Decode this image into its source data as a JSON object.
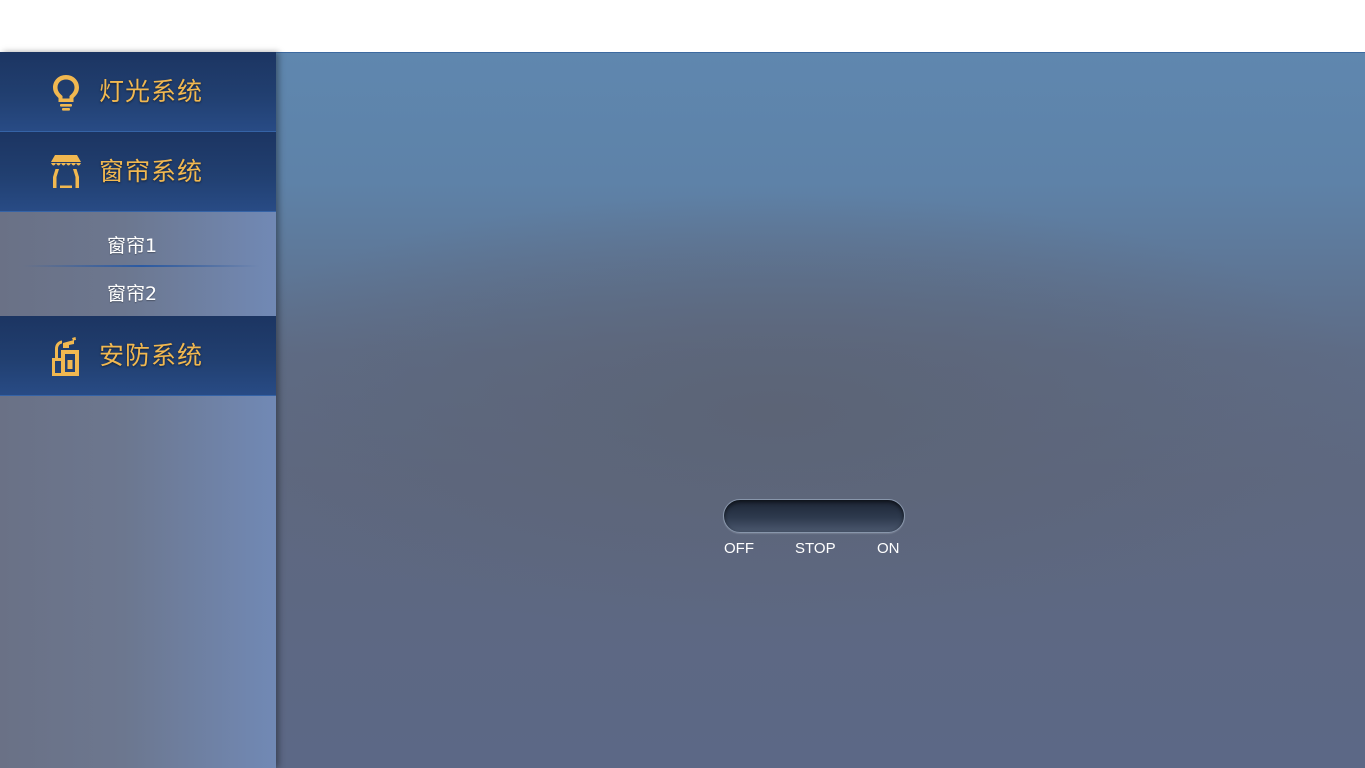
{
  "sidebar": {
    "menus": [
      {
        "label": "灯光系统",
        "icon": "lightbulb-icon"
      },
      {
        "label": "窗帘系统",
        "icon": "curtain-icon"
      },
      {
        "label": "安防系统",
        "icon": "fire-extinguisher-icon"
      }
    ],
    "curtain_items": [
      {
        "label": "窗帘1"
      },
      {
        "label": "窗帘2"
      }
    ]
  },
  "control": {
    "off_label": "OFF",
    "stop_label": "STOP",
    "on_label": "ON"
  },
  "colors": {
    "menu_text": "#f1b850",
    "menu_bg": "#213f70",
    "main_bg": "#5e6c86"
  }
}
